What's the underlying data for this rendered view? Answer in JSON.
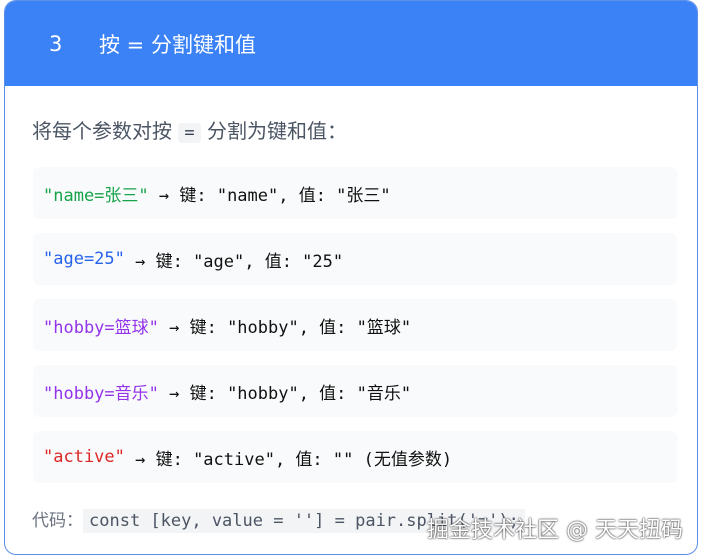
{
  "header": {
    "number": "3",
    "title": "按 = 分割键和值"
  },
  "intro": {
    "before": "将每个参数对按",
    "chip": "=",
    "after": "分割为键和值："
  },
  "colors": {
    "header": "#3b82f6",
    "green": "#16a34a",
    "blue": "#2563eb",
    "purple": "#9333ea",
    "red": "#dc2626"
  },
  "rows": [
    {
      "pair": "\"name=张三\"",
      "rest": " → 键: \"name\", 值: \"张三\""
    },
    {
      "pair": "\"age=25\"",
      "rest": " → 键: \"age\", 值: \"25\""
    },
    {
      "pair": "\"hobby=篮球\"",
      "rest": " → 键: \"hobby\", 值: \"篮球\""
    },
    {
      "pair": "\"hobby=音乐\"",
      "rest": " → 键: \"hobby\", 值: \"音乐\""
    },
    {
      "pair": "\"active\"",
      "rest": " → 键: \"active\", 值: \"\" (无值参数)"
    }
  ],
  "footer": {
    "label": "代码：",
    "code": "const [key, value = ''] = pair.split('=');"
  },
  "watermark": "掘金技术社区 @ 天天扭码"
}
